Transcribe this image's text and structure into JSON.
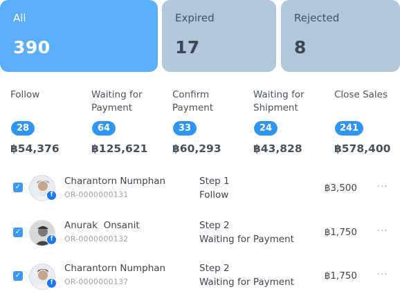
{
  "summary": [
    {
      "label": "All",
      "count": "390"
    },
    {
      "label": "Expired",
      "count": "17"
    },
    {
      "label": "Rejected",
      "count": "8"
    }
  ],
  "stages": [
    {
      "title": "Follow",
      "count": "28",
      "total": "฿54,376"
    },
    {
      "title": "Waiting for Payment",
      "count": "64",
      "total": "฿125,621"
    },
    {
      "title": "Confirm Payment",
      "count": "33",
      "total": "฿60,293"
    },
    {
      "title": "Waiting for Shipment",
      "count": "24",
      "total": "฿43,828"
    },
    {
      "title": "Close Sales",
      "count": "241",
      "total": "฿578,400"
    }
  ],
  "orders": [
    {
      "checked": "✓",
      "name": "Charantorn Numphan",
      "order_no": "OR-0000000131",
      "step": "Step 1",
      "status": "Follow",
      "amount": "฿3,500",
      "channel_icon": "facebook-icon",
      "more": "···"
    },
    {
      "checked": "✓",
      "name": "Anurak  Onsanit",
      "order_no": "OR-0000000132",
      "step": "Step 2",
      "status": "Waiting for Payment",
      "amount": "฿1,750",
      "channel_icon": "facebook-icon",
      "more": "···"
    },
    {
      "checked": "✓",
      "name": "Charantorn Numphan",
      "order_no": "OR-0000000137",
      "step": "Step 2",
      "status": "Waiting for Payment",
      "amount": "฿1,750",
      "channel_icon": "facebook-icon",
      "more": "···"
    }
  ],
  "colors": {
    "accent": "#5aaefa",
    "badge": "#2f95f3",
    "muted_card": "#b0c7dc",
    "facebook": "#1877f2"
  }
}
